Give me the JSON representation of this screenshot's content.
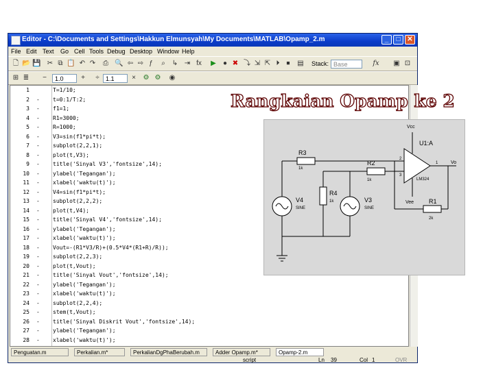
{
  "window": {
    "title": "Editor - C:\\Documents and Settings\\Hakkun Elmunsyah\\My Documents\\MATLAB\\Opamp_2.m",
    "minimize": "_",
    "maximize": "□",
    "close": "✕"
  },
  "menu": [
    "File",
    "Edit",
    "Text",
    "Go",
    "Cell",
    "Tools",
    "Debug",
    "Desktop",
    "Window",
    "Help"
  ],
  "toolbar": {
    "stack_label": "Stack:",
    "stack_value": "Base",
    "fx_label": "fx",
    "cell_value_1": "1.0",
    "minus": "−",
    "plus": "+",
    "div": "÷",
    "cell_value_2": "1.1",
    "times": "×"
  },
  "code_lines": [
    {
      "n": "1",
      "d": "",
      "t": "T=1/10;"
    },
    {
      "n": "2",
      "d": "-",
      "t": "t=0:1/T:2;"
    },
    {
      "n": "3",
      "d": "-",
      "t": "f1=1;"
    },
    {
      "n": "4",
      "d": "-",
      "t": "R1=3000;"
    },
    {
      "n": "5",
      "d": "-",
      "t": "R=1000;"
    },
    {
      "n": "6",
      "d": "-",
      "t": "V3=sin(f1*pi*t);"
    },
    {
      "n": "7",
      "d": "-",
      "t": "subplot(2,2,1);"
    },
    {
      "n": "8",
      "d": "-",
      "t": "plot(t,V3);"
    },
    {
      "n": "9",
      "d": "-",
      "t": "title('Sinyal V3','fontsize',14);"
    },
    {
      "n": "10",
      "d": "-",
      "t": "ylabel('Tegangan');"
    },
    {
      "n": "11",
      "d": "-",
      "t": "xlabel('waktu(t)');"
    },
    {
      "n": "12",
      "d": "-",
      "t": "V4=sin(f1*pi*t);"
    },
    {
      "n": "13",
      "d": "-",
      "t": "subplot(2,2,2);"
    },
    {
      "n": "14",
      "d": "-",
      "t": "plot(t,V4);"
    },
    {
      "n": "15",
      "d": "-",
      "t": "title('Sinyal V4','fontsize',14);"
    },
    {
      "n": "16",
      "d": "-",
      "t": "ylabel('Tegangan');"
    },
    {
      "n": "17",
      "d": "-",
      "t": "xlabel('waktu(t)');"
    },
    {
      "n": "18",
      "d": "-",
      "t": "Vout=-(R1*V3/R)+(0.5*V4*(R1+R)/R));"
    },
    {
      "n": "19",
      "d": "-",
      "t": "subplot(2,2,3);"
    },
    {
      "n": "20",
      "d": "-",
      "t": "plot(t,Vout);"
    },
    {
      "n": "21",
      "d": "-",
      "t": "title('Sinyal Vout','fontsize',14);"
    },
    {
      "n": "22",
      "d": "-",
      "t": "ylabel('Tegangan');"
    },
    {
      "n": "23",
      "d": "-",
      "t": "xlabel('waktu(t)');"
    },
    {
      "n": "24",
      "d": "-",
      "t": "subplot(2,2,4);"
    },
    {
      "n": "25",
      "d": "-",
      "t": "stem(t,Vout);"
    },
    {
      "n": "26",
      "d": "-",
      "t": "title('Sinyal Diskrit Vout','fontsize',14);"
    },
    {
      "n": "27",
      "d": "-",
      "t": "ylabel('Tegangan');"
    },
    {
      "n": "28",
      "d": "-",
      "t": "xlabel('waktu(t)');"
    }
  ],
  "tabs": [
    "Penguatan.m",
    "Perkalian.m*",
    "PerkalianDgPhaBerubah.m",
    "Adder Opamp.m*",
    "Opamp-2.m"
  ],
  "status": {
    "mode": "script",
    "ln_label": "Ln",
    "ln_value": "39",
    "col_label": "Col",
    "col_value": "1",
    "ovr": "OVR"
  },
  "overlay_title": "Rangkaian Opamp ke 2",
  "schematic": {
    "opamp_ref": "U1:A",
    "opamp_model": "LM324",
    "vcc": "Vcc",
    "vee": "Vee",
    "pin1": "1",
    "pin2": "2",
    "pin3": "3",
    "r3": "R3",
    "r3_val": "1k",
    "r2": "R2",
    "r2_val": "1k",
    "r4": "R4",
    "r4_val": "1k",
    "r1": "R1",
    "r1_val": "2k",
    "v4": "V4",
    "v4_val": "SINE",
    "v3": "V3",
    "v3_val": "SINE",
    "vo": "Vo"
  }
}
